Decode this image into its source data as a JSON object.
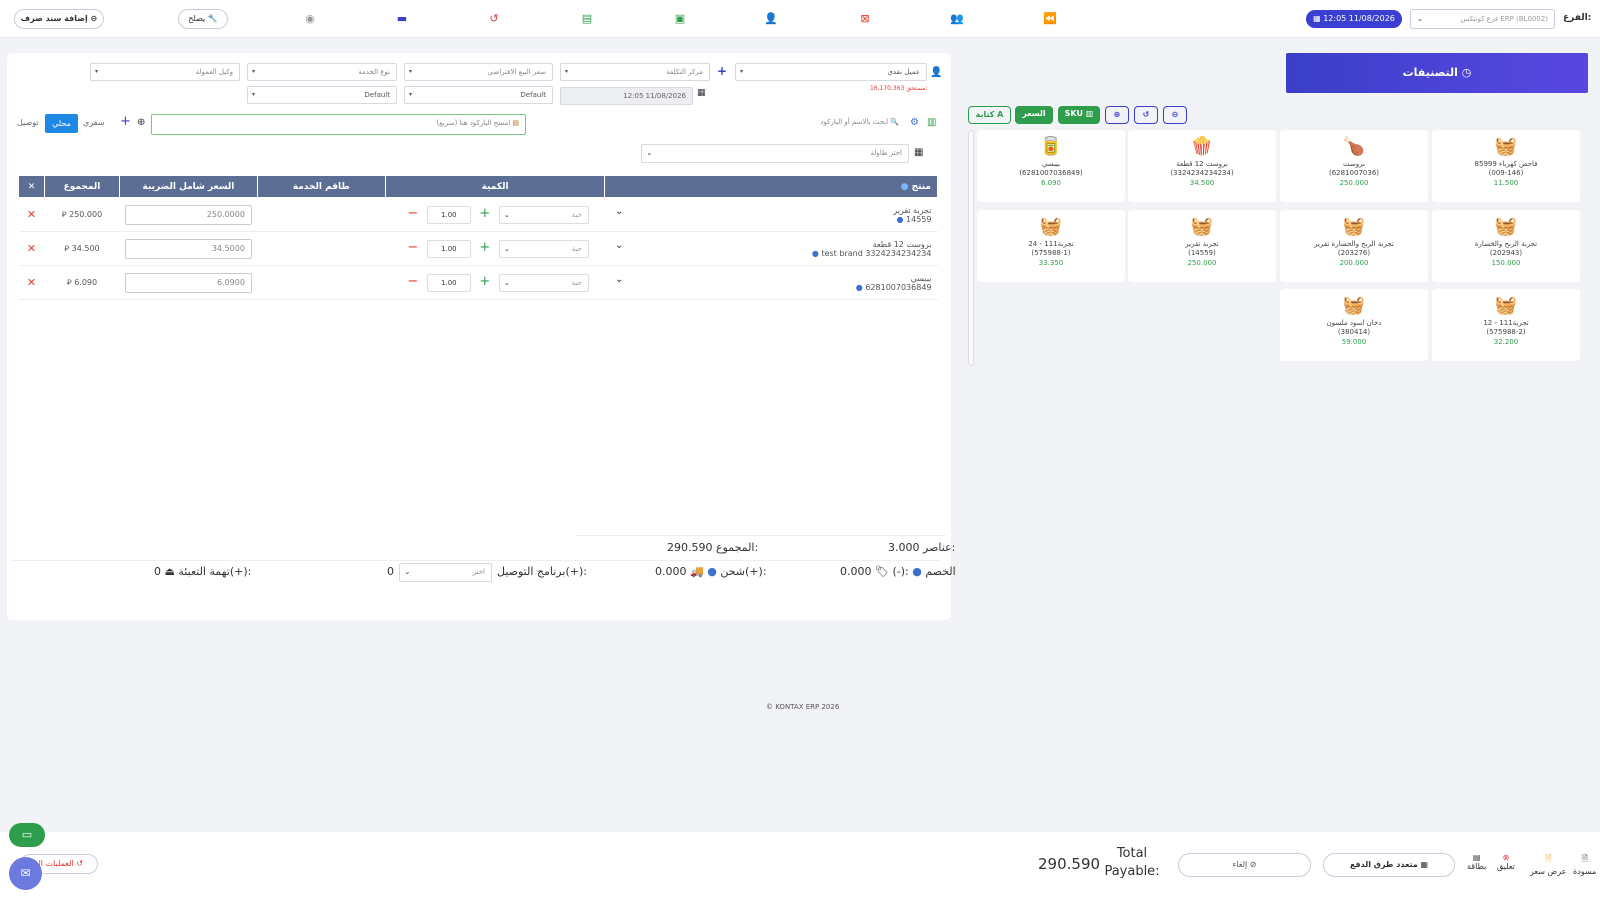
{
  "topbar": {
    "branch_label": "الفرع:",
    "branch_value": "فرع كونتكس ERP (BL0002)",
    "datetime": "12:05 11/08/2026",
    "repair_label": "يصلح",
    "add_expense_label": "إضافة سند صرف"
  },
  "form": {
    "customer": "عميل نقدي",
    "balance_label": "مستحق:",
    "balance_value": "16,170.363",
    "cost_center": "مركز التكلفة",
    "default_price": "سعر البيع الافتراضي",
    "service_type": "نوع الخدمة",
    "commission_agent": "وكيل العمولة",
    "date": "12:05 11/08/2026",
    "default1": "Default",
    "default2": "Default",
    "search_placeholder": "ابحث بالاسم أو الباركود",
    "barcode_placeholder": "امسح الباركود هنا (سريع)",
    "table_placeholder": "اختر طاولة",
    "tab_delivery": "توصيل",
    "tab_local": "محلي",
    "tab_travel": "سفري"
  },
  "table": {
    "headers": {
      "product": "منتج",
      "quantity": "الكمية",
      "service_staff": "طاقم الخدمة",
      "price_incl_tax": "السعر شامل الضريبة",
      "total": "المجموع"
    },
    "rows": [
      {
        "name": "تجربة تقرير",
        "code": "14559",
        "qty": "1.00",
        "unit": "حبة",
        "price": "250.0000",
        "total": "250.000"
      },
      {
        "name": "بروست 12 قطعة",
        "code": "test brand 3324234234234",
        "qty": "1.00",
        "unit": "حبة",
        "price": "34.5000",
        "total": "34.500"
      },
      {
        "name": "بيبسي",
        "code": "6281007036849",
        "qty": "1.00",
        "unit": "حبة",
        "price": "6.0900",
        "total": "6.090"
      }
    ]
  },
  "summary": {
    "items_label": "عناصر:",
    "items_value": "3.000",
    "total_label": "المجموع:",
    "total_value": "290.590",
    "discount_label": "الخصم",
    "discount_sign": "(-):",
    "discount_value": "0.000",
    "shipping_label": "شحن(+):",
    "shipping_value": "0.000",
    "delivery_label": "برنامج التوصيل(+):",
    "delivery_placeholder": "اختر",
    "delivery_value": "0",
    "packing_label": "تهمة التعبئة(+):",
    "packing_value": "0"
  },
  "footer_copyright": "© KONTAX ERP 2026",
  "categories": {
    "button_label": "التصنيفات",
    "tool_letter": "كتابة",
    "tool_price": "السعر",
    "tool_sku": "SKU",
    "products": [
      {
        "name": "فاحص كهرباء 85999",
        "code": "(009-146)",
        "price": "11.500",
        "img": "basket"
      },
      {
        "name": "بروست",
        "code": "(6281007036)",
        "price": "250.000",
        "img": "chicken"
      },
      {
        "name": "بروست 12 قطعة",
        "code": "(3324234234234)",
        "price": "34.500",
        "img": "bucket"
      },
      {
        "name": "بيبسي",
        "code": "(6281007036849)",
        "price": "6.090",
        "img": "can"
      },
      {
        "name": "تجربة الربح والخسارة",
        "code": "(202943)",
        "price": "150.000",
        "img": "basket"
      },
      {
        "name": "تجربة الربح والخسارة تقرير",
        "code": "(203276)",
        "price": "200.000",
        "img": "basket"
      },
      {
        "name": "تجربة تقرير",
        "code": "(14559)",
        "price": "250.000",
        "img": "basket"
      },
      {
        "name": "تجربة111 - 24",
        "code": "(575988-1)",
        "price": "33.350",
        "img": "basket"
      },
      {
        "name": "تجربة111 - 12",
        "code": "(575988-2)",
        "price": "32.200",
        "img": "basket"
      },
      {
        "name": "دخان اسود ملسون",
        "code": "(380414)",
        "price": "59.000",
        "img": "basket"
      }
    ]
  },
  "bottom": {
    "draft": "مسودة",
    "quote": "عرض سعر",
    "suspend": "تعليق",
    "card": "بطاقة",
    "multi_pay": "متعدد طرق الدفع",
    "cancel": "إلغاء",
    "total_payable_label": "Total Payable:",
    "total_payable_value": "290.590",
    "recent_tx": "العمليات ال"
  },
  "colors": {
    "primary": "#3b3fc9",
    "table_header": "#5c6e93",
    "green": "#2e9e4c",
    "red": "#e53935",
    "active_tab": "#1e88e5"
  }
}
